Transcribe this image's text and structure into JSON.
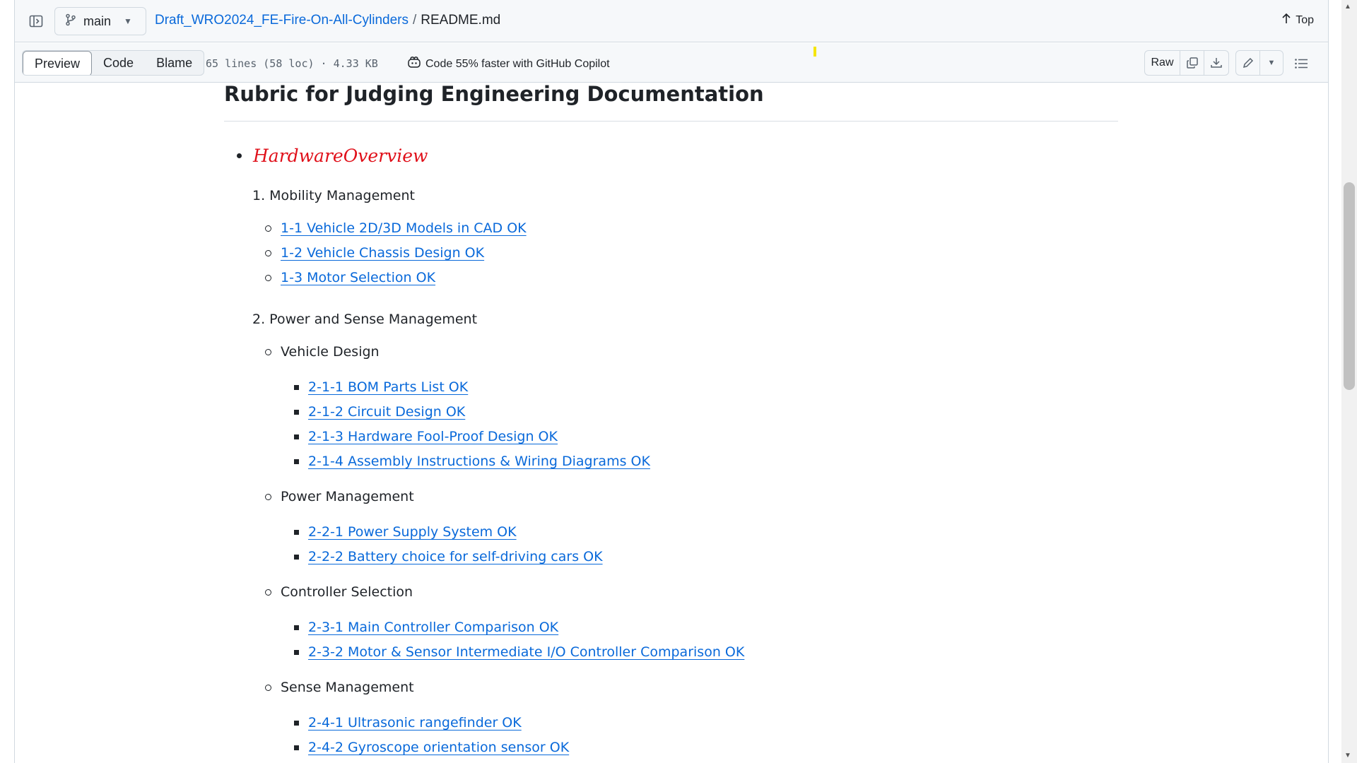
{
  "header": {
    "branch": "main",
    "repo_link": "Draft_WRO2024_FE-Fire-On-All-Cylinders",
    "separator": "/",
    "file_name": "README.md",
    "top_label": "Top"
  },
  "toolbar": {
    "tabs": [
      "Preview",
      "Code",
      "Blame"
    ],
    "active_tab": "Preview",
    "file_info": "65 lines (58 loc) · 4.33 KB",
    "copilot_text": "Code 55% faster with GitHub Copilot",
    "raw_label": "Raw"
  },
  "content": {
    "heading": "Rubric for Judging Engineering Documentation",
    "hardware_overview": "HardwareOverview",
    "section1": {
      "title": "1. Mobility Management",
      "links": [
        "1-1 Vehicle 2D/3D Models in CAD OK",
        "1-2 Vehicle Chassis Design OK",
        "1-3 Motor Selection OK"
      ]
    },
    "section2": {
      "title": "2. Power and Sense Management",
      "groups": [
        {
          "title": "Vehicle Design",
          "links": [
            "2-1-1 BOM Parts List OK",
            "2-1-2 Circuit Design OK",
            "2-1-3 Hardware Fool-Proof Design OK",
            "2-1-4 Assembly Instructions & Wiring Diagrams OK"
          ]
        },
        {
          "title": "Power Management",
          "links": [
            "2-2-1 Power Supply System OK",
            "2-2-2 Battery choice for self-driving cars OK"
          ]
        },
        {
          "title": "Controller Selection",
          "links": [
            "2-3-1 Main Controller Comparison OK",
            "2-3-2 Motor & Sensor Intermediate I/O Controller Comparison OK"
          ]
        },
        {
          "title": "Sense Management",
          "links": [
            "2-4-1 Ultrasonic rangefinder OK",
            "2-4-2 Gyroscope orientation sensor OK"
          ]
        }
      ]
    }
  }
}
